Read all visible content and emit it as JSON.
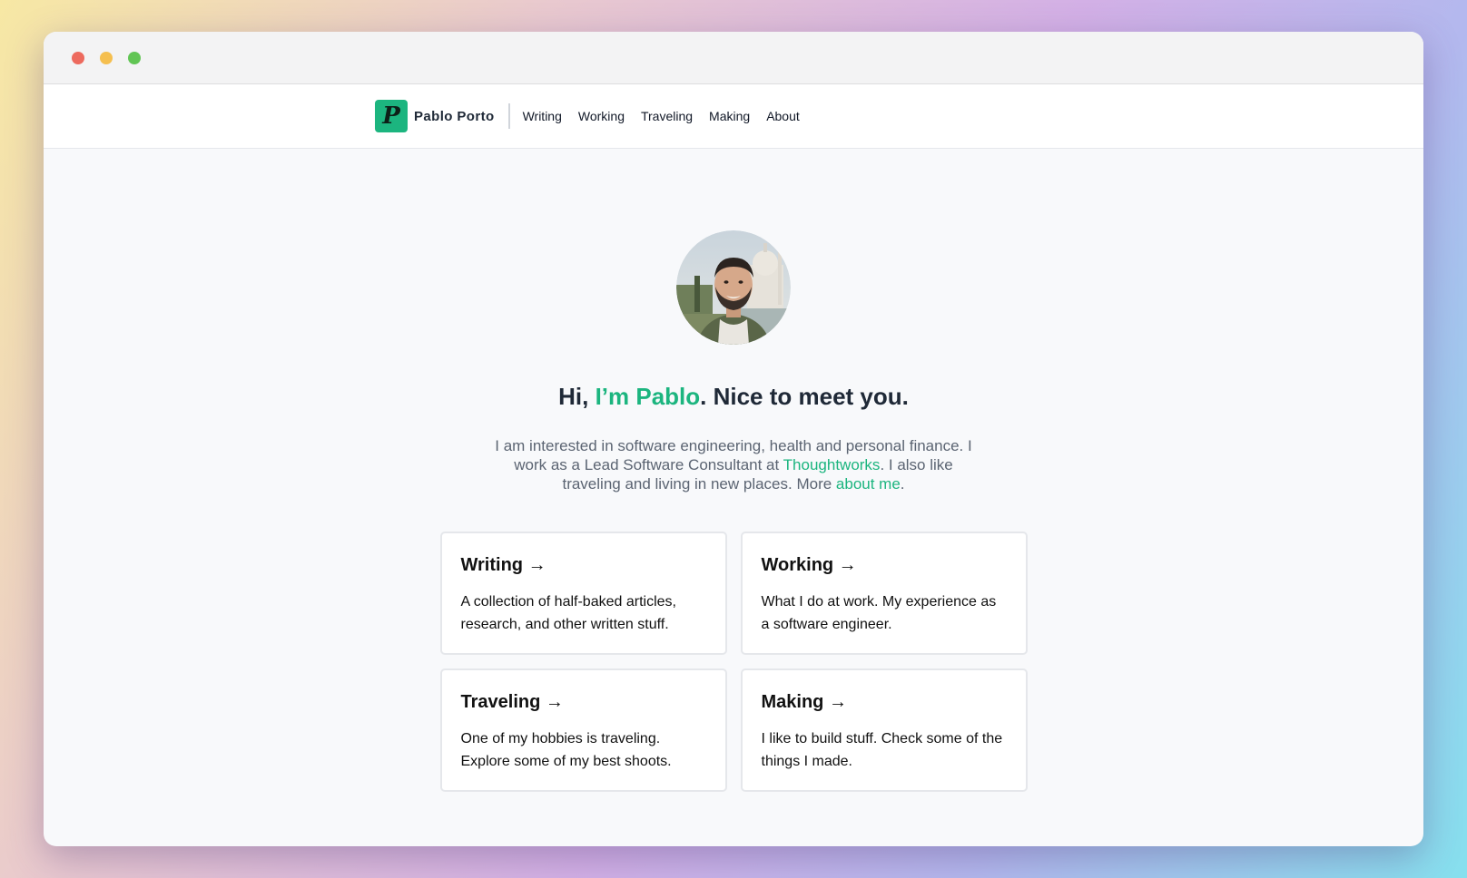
{
  "window": {
    "controls": [
      {
        "name": "close-window-button",
        "color": "#ed6a5e"
      },
      {
        "name": "minimize-window-button",
        "color": "#f5bf4f"
      },
      {
        "name": "maximize-window-button",
        "color": "#61c554"
      }
    ]
  },
  "navbar": {
    "logo_letter": "P",
    "brand": "Pablo Porto",
    "links": [
      "Writing",
      "Working",
      "Traveling",
      "Making",
      "About"
    ]
  },
  "hero": {
    "headline_pre": "Hi, ",
    "headline_name": "I’m Pablo",
    "headline_post": ". Nice to meet you.",
    "intro_part1": "I am interested in software engineering, health and personal finance. I work as a Lead Software Consultant at ",
    "intro_link1": "Thoughtworks",
    "intro_part2": ". I also like traveling and living in new places. More ",
    "intro_link2": "about me",
    "intro_part3": "."
  },
  "cards": [
    {
      "title": "Writing →",
      "description": "A collection of half-baked articles, research, and other written stuff."
    },
    {
      "title": "Working →",
      "description": "What I do at work. My experience as a software engineer."
    },
    {
      "title": "Traveling →",
      "description": "One of my hobbies is traveling. Explore some of my best shoots."
    },
    {
      "title": "Making →",
      "description": "I like to build stuff. Check some of the things I made."
    }
  ],
  "colors": {
    "accent": "#1cb57f",
    "text_dark": "#1f2937",
    "text_muted": "#5b6472"
  }
}
